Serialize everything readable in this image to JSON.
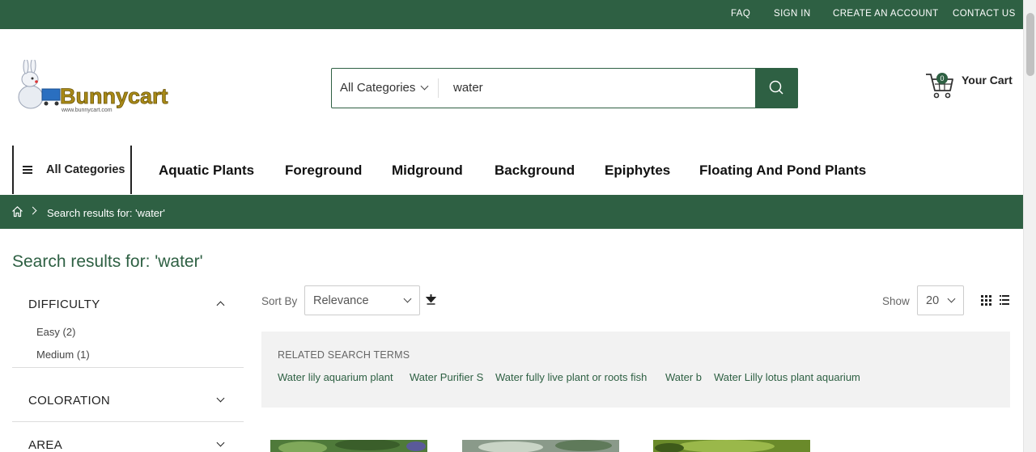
{
  "topbar": {
    "links": [
      "FAQ",
      "SIGN IN",
      "CREATE AN ACCOUNT",
      "CONTACT US"
    ]
  },
  "logo": {
    "text": "Bunnycart",
    "url_text": "www.bunnycart.com"
  },
  "search": {
    "category": "All Categories",
    "query": "water"
  },
  "cart": {
    "count": "0",
    "label": "Your Cart"
  },
  "nav": {
    "all_categories": "All Categories",
    "items": [
      "Aquatic Plants",
      "Foreground",
      "Midground",
      "Background",
      "Epiphytes",
      "Floating And Pond Plants"
    ]
  },
  "breadcrumb": {
    "current": "Search results for: 'water'"
  },
  "page_title": "Search results for: 'water'",
  "filters": {
    "difficulty": {
      "title": "DIFFICULTY",
      "options": [
        "Easy (2)",
        "Medium (1)"
      ]
    },
    "coloration": {
      "title": "COLORATION"
    },
    "area": {
      "title": "AREA"
    }
  },
  "toolbar": {
    "sort_label": "Sort By",
    "sort_value": "Relevance",
    "show_label": "Show",
    "show_value": "20"
  },
  "related": {
    "heading": "RELATED SEARCH TERMS",
    "terms": [
      "Water lily aquarium plant",
      "Water Purifier S",
      "Water fully live plant or roots fish",
      "Water b",
      "Water Lilly lotus plant aquarium"
    ]
  },
  "colors": {
    "brand_green": "#2e6043"
  }
}
